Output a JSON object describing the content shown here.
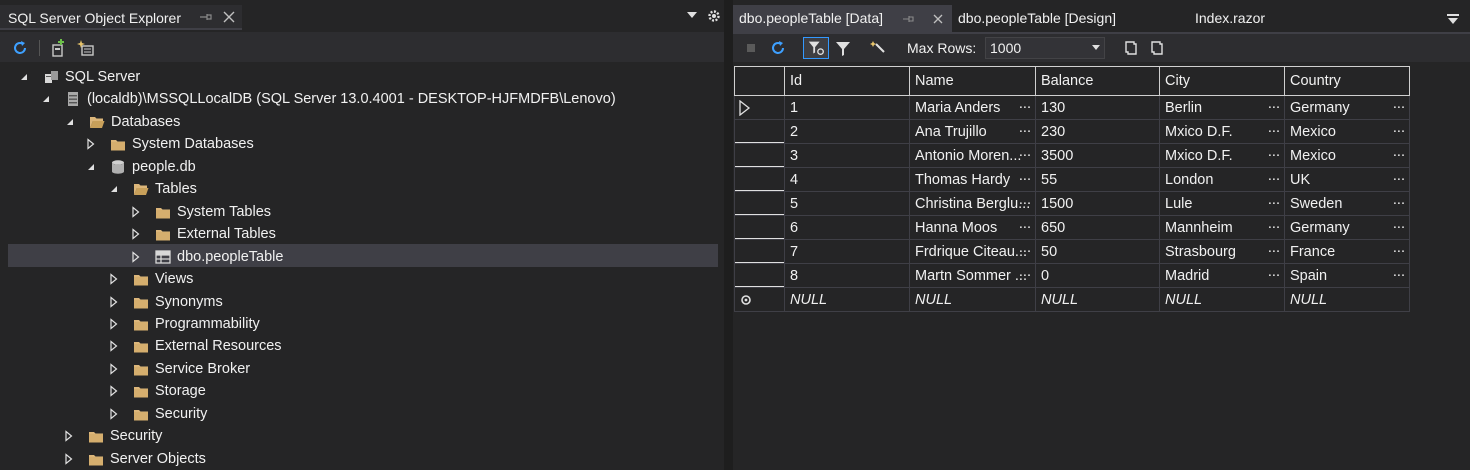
{
  "object_explorer": {
    "title": "SQL Server Object Explorer",
    "toolbar": {
      "refresh_icon": "refresh-icon",
      "add_server_icon": "add-server-icon",
      "new_query_icon": "new-query-icon"
    },
    "tree": [
      {
        "id": "sql-server",
        "label": "SQL Server",
        "icon": "server-group-icon"
      },
      {
        "id": "localdb",
        "label": "(localdb)\\MSSQLLocalDB (SQL Server 13.0.4001 - DESKTOP-HJFMDFB\\Lenovo)",
        "icon": "server-icon"
      },
      {
        "id": "databases",
        "label": "Databases",
        "icon": "folder-open-icon"
      },
      {
        "id": "system-databases",
        "label": "System Databases",
        "icon": "folder-icon"
      },
      {
        "id": "people-db",
        "label": "people.db",
        "icon": "database-icon"
      },
      {
        "id": "tables",
        "label": "Tables",
        "icon": "folder-open-icon"
      },
      {
        "id": "system-tables",
        "label": "System Tables",
        "icon": "folder-icon"
      },
      {
        "id": "external-tables",
        "label": "External Tables",
        "icon": "folder-icon"
      },
      {
        "id": "people-table",
        "label": "dbo.peopleTable",
        "icon": "table-icon",
        "selected": true
      },
      {
        "id": "views",
        "label": "Views",
        "icon": "folder-icon"
      },
      {
        "id": "synonyms",
        "label": "Synonyms",
        "icon": "folder-icon"
      },
      {
        "id": "programmability",
        "label": "Programmability",
        "icon": "folder-icon"
      },
      {
        "id": "external-resources",
        "label": "External Resources",
        "icon": "folder-icon"
      },
      {
        "id": "service-broker",
        "label": "Service Broker",
        "icon": "folder-icon"
      },
      {
        "id": "storage",
        "label": "Storage",
        "icon": "folder-icon"
      },
      {
        "id": "security-db",
        "label": "Security",
        "icon": "folder-icon"
      },
      {
        "id": "security-server",
        "label": "Security",
        "icon": "folder-icon"
      },
      {
        "id": "server-objects",
        "label": "Server Objects",
        "icon": "folder-icon"
      }
    ]
  },
  "editor": {
    "tabs": [
      {
        "label": "dbo.peopleTable [Data]",
        "active": true
      },
      {
        "label": "dbo.peopleTable [Design]",
        "active": false
      },
      {
        "label": "Index.razor",
        "active": false
      }
    ],
    "toolbar": {
      "max_rows_label": "Max Rows:",
      "max_rows_value": "1000"
    },
    "grid": {
      "columns": [
        "Id",
        "Name",
        "Balance",
        "City",
        "Country"
      ],
      "rows": [
        [
          "1",
          "Maria Anders",
          "130",
          "Berlin",
          "Germany"
        ],
        [
          "2",
          "Ana Trujillo",
          "230",
          "Mxico D.F.",
          "Mexico"
        ],
        [
          "3",
          "Antonio Moren...",
          "3500",
          "Mxico D.F.",
          "Mexico"
        ],
        [
          "4",
          "Thomas Hardy",
          "55",
          "London",
          "UK"
        ],
        [
          "5",
          "Christina Berglu...",
          "1500",
          "Lule",
          "Sweden"
        ],
        [
          "6",
          "Hanna Moos",
          "650",
          "Mannheim",
          "Germany"
        ],
        [
          "7",
          "Frdrique Citeau...",
          "50",
          "Strasbourg",
          "France"
        ],
        [
          "8",
          "Martn Sommer ...",
          "0",
          "Madrid",
          "Spain"
        ]
      ],
      "new_row": [
        "NULL",
        "NULL",
        "NULL",
        "NULL",
        "NULL"
      ],
      "cell_ellipsis": "..."
    }
  },
  "colors": {
    "background": "#252526",
    "toolbar": "#2d2d30",
    "selection": "#3f3f46",
    "folder": "#dcb67a",
    "accent": "#3399ff"
  }
}
